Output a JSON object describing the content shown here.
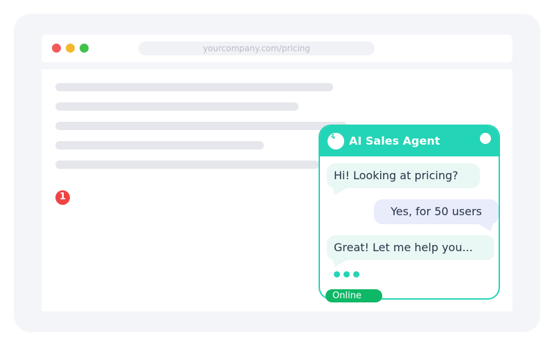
{
  "browser": {
    "url": "yourcompany.com/pricing"
  },
  "notification": {
    "count": "1"
  },
  "chat": {
    "title": "AI Sales Agent",
    "messages": [
      {
        "from": "agent",
        "text": "Hi! Looking at pricing?"
      },
      {
        "from": "user",
        "text": "Yes, for 50 users"
      },
      {
        "from": "agent",
        "text": "Great! Let me help you..."
      }
    ],
    "status": "Online"
  },
  "colors": {
    "accent": "#23d4b6",
    "online": "#0fb866",
    "badge": "#ef4444"
  },
  "icons": {
    "window_controls": [
      "close-dot",
      "minimize-dot",
      "maximize-dot"
    ],
    "agent": "agent-avatar-icon",
    "header_control": "chat-toggle-icon",
    "typing": "typing-indicator-icon"
  }
}
